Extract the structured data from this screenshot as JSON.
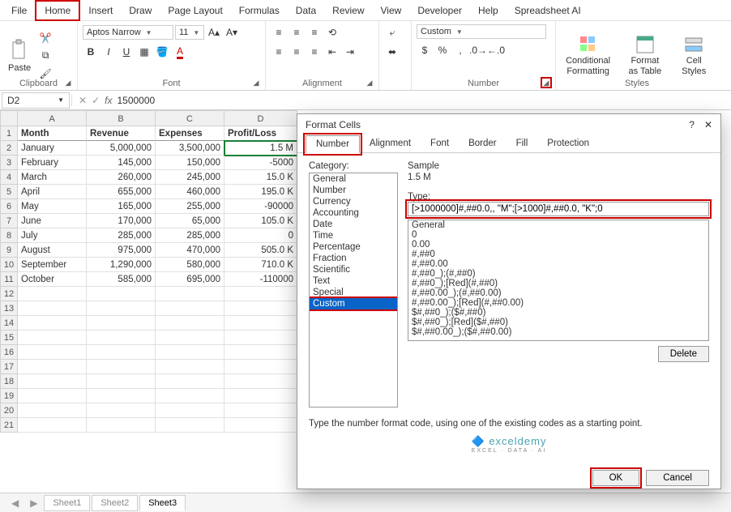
{
  "menu": [
    "File",
    "Home",
    "Insert",
    "Draw",
    "Page Layout",
    "Formulas",
    "Data",
    "Review",
    "View",
    "Developer",
    "Help",
    "Spreadsheet AI"
  ],
  "menu_active": 1,
  "ribbon": {
    "clipboard": {
      "paste": "Paste",
      "label": "Clipboard"
    },
    "font": {
      "name": "Aptos Narrow",
      "size": "11",
      "label": "Font"
    },
    "align": {
      "label": "Alignment"
    },
    "number": {
      "format": "Custom",
      "label": "Number"
    },
    "styles": {
      "cf": "Conditional Formatting",
      "ft": "Format as Table",
      "cs": "Cell Styles",
      "label": "Styles"
    }
  },
  "namebox": "D2",
  "formula": "1500000",
  "columns": [
    "A",
    "B",
    "C",
    "D"
  ],
  "headers": [
    "Month",
    "Revenue",
    "Expenses",
    "Profit/Loss"
  ],
  "rows": [
    {
      "m": "January",
      "r": "5,000,000",
      "e": "3,500,000",
      "p": "1.5 M"
    },
    {
      "m": "February",
      "r": "145,000",
      "e": "150,000",
      "p": "-5000"
    },
    {
      "m": "March",
      "r": "260,000",
      "e": "245,000",
      "p": "15.0 K"
    },
    {
      "m": "April",
      "r": "655,000",
      "e": "460,000",
      "p": "195.0 K"
    },
    {
      "m": "May",
      "r": "165,000",
      "e": "255,000",
      "p": "-90000"
    },
    {
      "m": "June",
      "r": "170,000",
      "e": "65,000",
      "p": "105.0 K"
    },
    {
      "m": "July",
      "r": "285,000",
      "e": "285,000",
      "p": "0"
    },
    {
      "m": "August",
      "r": "975,000",
      "e": "470,000",
      "p": "505.0 K"
    },
    {
      "m": "September",
      "r": "1,290,000",
      "e": "580,000",
      "p": "710.0 K"
    },
    {
      "m": "October",
      "r": "585,000",
      "e": "695,000",
      "p": "-110000"
    }
  ],
  "sheets": [
    "Sheet1",
    "Sheet2",
    "Sheet3"
  ],
  "sheet_active": 2,
  "dialog": {
    "title": "Format Cells",
    "tabs": [
      "Number",
      "Alignment",
      "Font",
      "Border",
      "Fill",
      "Protection"
    ],
    "cat_label": "Category:",
    "categories": [
      "General",
      "Number",
      "Currency",
      "Accounting",
      "Date",
      "Time",
      "Percentage",
      "Fraction",
      "Scientific",
      "Text",
      "Special",
      "Custom"
    ],
    "cat_sel": 11,
    "sample_label": "Sample",
    "sample": "1.5 M",
    "type_label": "Type:",
    "type_value": "[>1000000]#,##0.0,, \"M\";[>1000]#,##0.0, \"K\";0",
    "formats": [
      "General",
      "0",
      "0.00",
      "#,##0",
      "#,##0.00",
      "#,##0_);(#,##0)",
      "#,##0_);[Red](#,##0)",
      "#,##0.00_);(#,##0.00)",
      "#,##0.00_);[Red](#,##0.00)",
      "$#,##0_);($#,##0)",
      "$#,##0_);[Red]($#,##0)",
      "$#,##0.00_);($#,##0.00)"
    ],
    "delete": "Delete",
    "hint": "Type the number format code, using one of the existing codes as a starting point.",
    "watermark": "exceldemy",
    "watermark_sub": "EXCEL · DATA · AI",
    "ok": "OK",
    "cancel": "Cancel"
  }
}
